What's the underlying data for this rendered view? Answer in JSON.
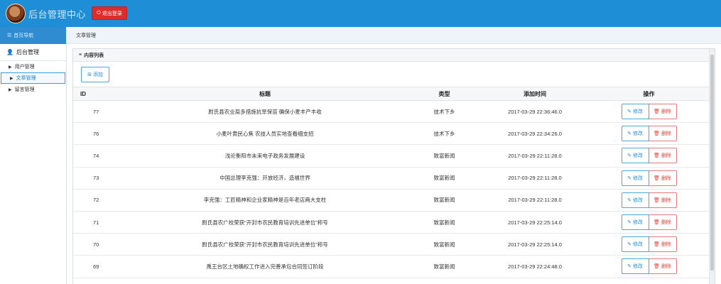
{
  "header": {
    "app_title": "后台管理中心",
    "logout_label": "退出登录",
    "accent": "#1e8fd6",
    "danger": "#e02b2b"
  },
  "subbar": {
    "home_label": "首页导航",
    "breadcrumb": "文章管理"
  },
  "sidebar": {
    "section": "后台管理",
    "items": [
      {
        "label": "用户管理",
        "active": false
      },
      {
        "label": "文章管理",
        "active": true
      },
      {
        "label": "留言管理",
        "active": false
      }
    ]
  },
  "panel": {
    "title": "内容列表",
    "add_label": "添加"
  },
  "table": {
    "columns": [
      "ID",
      "标题",
      "类型",
      "添加时间",
      "操作"
    ],
    "edit_label": "修改",
    "delete_label": "删除",
    "rows": [
      {
        "id": "77",
        "title": "尉氏县农业局多措施抗旱保苗 确保小麦丰产丰收",
        "type": "技术下乡",
        "time": "2017-03-29 22:36:46.0"
      },
      {
        "id": "76",
        "title": "小麦叶黄民心焦 农技人员实地查看细支招",
        "type": "技术下乡",
        "time": "2017-03-29 22:34:26.0"
      },
      {
        "id": "74",
        "title": "浅论衡阳市未来电子政务发展建设",
        "type": "致富新闻",
        "time": "2017-03-29 22:11:28.0"
      },
      {
        "id": "73",
        "title": "中国总理李克强：开放经济，造福世界",
        "type": "致富新闻",
        "time": "2017-03-29 22:11:28.0"
      },
      {
        "id": "72",
        "title": "李克强：工匠精神和企业家精神是百年老店两大支柱",
        "type": "致富新闻",
        "time": "2017-03-29 22:11:28.0"
      },
      {
        "id": "71",
        "title": "尉氏县农广校荣获“开封市农民教育培训先进单位”称号",
        "type": "致富新闻",
        "time": "2017-03-29 22:25:14.0"
      },
      {
        "id": "70",
        "title": "尉氏县农广校荣获“开封市农民教育培训先进单位”称号",
        "type": "致富新闻",
        "time": "2017-03-29 22:25:14.0"
      },
      {
        "id": "69",
        "title": "禹王台区土地确权工作进入完善承包合同签订阶段",
        "type": "致富新闻",
        "time": "2017-03-29 22:24:48.0"
      }
    ]
  }
}
